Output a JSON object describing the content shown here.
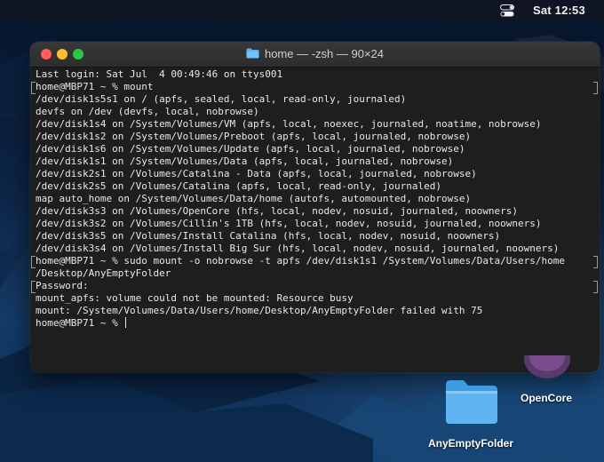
{
  "menubar": {
    "clock": "Sat 12:53",
    "control_center_icon": "control-center-icon"
  },
  "window": {
    "title": "home — -zsh — 90×24",
    "title_icon": "folder-icon"
  },
  "terminal": {
    "lines": [
      "Last login: Sat Jul  4 00:49:46 on ttys001",
      "home@MBP71 ~ % mount",
      "/dev/disk1s5s1 on / (apfs, sealed, local, read-only, journaled)",
      "devfs on /dev (devfs, local, nobrowse)",
      "/dev/disk1s4 on /System/Volumes/VM (apfs, local, noexec, journaled, noatime, nobrowse)",
      "/dev/disk1s2 on /System/Volumes/Preboot (apfs, local, journaled, nobrowse)",
      "/dev/disk1s6 on /System/Volumes/Update (apfs, local, journaled, nobrowse)",
      "/dev/disk1s1 on /System/Volumes/Data (apfs, local, journaled, nobrowse)",
      "/dev/disk2s1 on /Volumes/Catalina - Data (apfs, local, journaled, nobrowse)",
      "/dev/disk2s5 on /Volumes/Catalina (apfs, local, read-only, journaled)",
      "map auto_home on /System/Volumes/Data/home (autofs, automounted, nobrowse)",
      "/dev/disk3s3 on /Volumes/OpenCore (hfs, local, nodev, nosuid, journaled, noowners)",
      "/dev/disk3s2 on /Volumes/Cillín's 1TB (hfs, local, nodev, nosuid, journaled, noowners)",
      "/dev/disk3s5 on /Volumes/Install Catalina (hfs, local, nodev, nosuid, noowners)",
      "/dev/disk3s4 on /Volumes/Install Big Sur (hfs, local, nodev, nosuid, journaled, noowners)",
      "home@MBP71 ~ % sudo mount -o nobrowse -t apfs /dev/disk1s1 /System/Volumes/Data/Users/home",
      "/Desktop/AnyEmptyFolder",
      "Password:",
      "mount_apfs: volume could not be mounted: Resource busy",
      "mount: /System/Volumes/Data/Users/home/Desktop/AnyEmptyFolder failed with 75",
      "home@MBP71 ~ % "
    ]
  },
  "desktop": {
    "folder_label": "AnyEmptyFolder",
    "disk_label": "OpenCore"
  }
}
